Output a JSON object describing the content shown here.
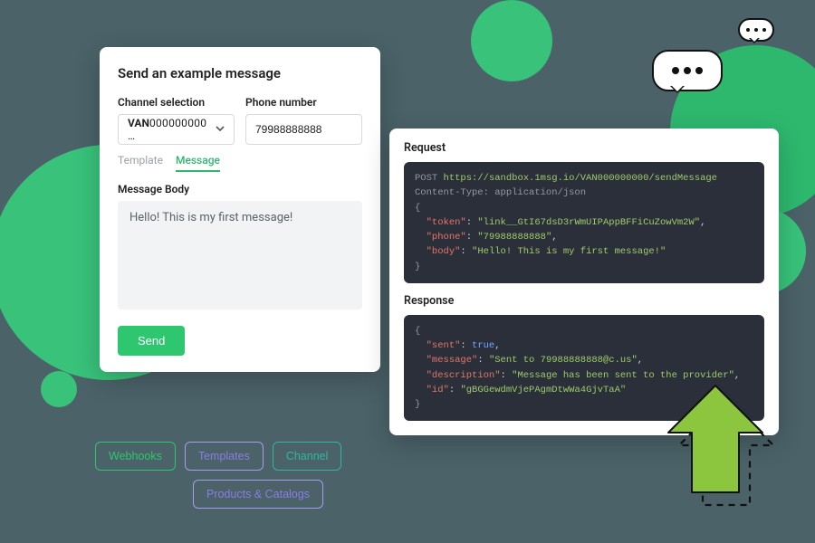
{
  "form": {
    "title": "Send an example message",
    "channel_label": "Channel selection",
    "channel_value_prefix": "VAN",
    "channel_value_rest": "000000000 …",
    "phone_label": "Phone number",
    "phone_value": "79988888888",
    "tabs": {
      "template": "Template",
      "message": "Message"
    },
    "body_label": "Message Body",
    "body_value": "Hello! This is my first message!",
    "send_label": "Send"
  },
  "request": {
    "heading": "Request",
    "method": "POST",
    "url": "https://sandbox.1msg.io/VAN000000000/sendMessage",
    "content_type_line": "Content-Type: application/json",
    "fields": {
      "token": "link__GtI67dsD3rWmUIPAppBFFiCuZowVm2W",
      "phone": "79988888888",
      "body": "Hello! This is my first message!"
    }
  },
  "response": {
    "heading": "Response",
    "fields": {
      "sent": true,
      "message": "Sent to 79988888888@c.us",
      "description": "Message has been sent to the provider",
      "id": "gBGGewdmVjePAgmDtwWa4GjvTaA"
    }
  },
  "tags": {
    "webhooks": "Webhooks",
    "templates": "Templates",
    "channel": "Channel",
    "products": "Products & Catalogs"
  }
}
